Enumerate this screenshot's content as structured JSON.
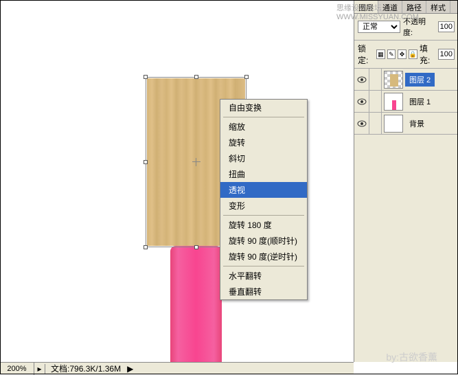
{
  "watermark": {
    "top": "思缘设计论坛  WWW.MISSYUAN.COM",
    "bottom": "by:古欲香薰"
  },
  "context_menu": {
    "items": [
      {
        "label": "自由变换",
        "sep_after": true
      },
      {
        "label": "缩放"
      },
      {
        "label": "旋转"
      },
      {
        "label": "斜切"
      },
      {
        "label": "扭曲"
      },
      {
        "label": "透视",
        "highlighted": true
      },
      {
        "label": "变形",
        "sep_after": true
      },
      {
        "label": "旋转 180 度"
      },
      {
        "label": "旋转 90 度(顺时针)"
      },
      {
        "label": "旋转 90 度(逆时针)",
        "sep_after": true
      },
      {
        "label": "水平翻转"
      },
      {
        "label": "垂直翻转"
      }
    ]
  },
  "panel": {
    "tabs": [
      "图层",
      "通道",
      "路径",
      "样式"
    ],
    "blend_mode": "正常",
    "opacity_label": "不透明度:",
    "opacity_value": "100",
    "lock_label": "锁定:",
    "fill_label": "填充:",
    "fill_value": "100",
    "layers": [
      {
        "name": "图层 2",
        "selected": true,
        "thumb": "checker"
      },
      {
        "name": "图层 1",
        "thumb": "pink"
      },
      {
        "name": "背景",
        "thumb": "white"
      }
    ]
  },
  "status": {
    "zoom": "200%",
    "doc_label": "文档:",
    "doc_info": "796.3K/1.36M"
  }
}
